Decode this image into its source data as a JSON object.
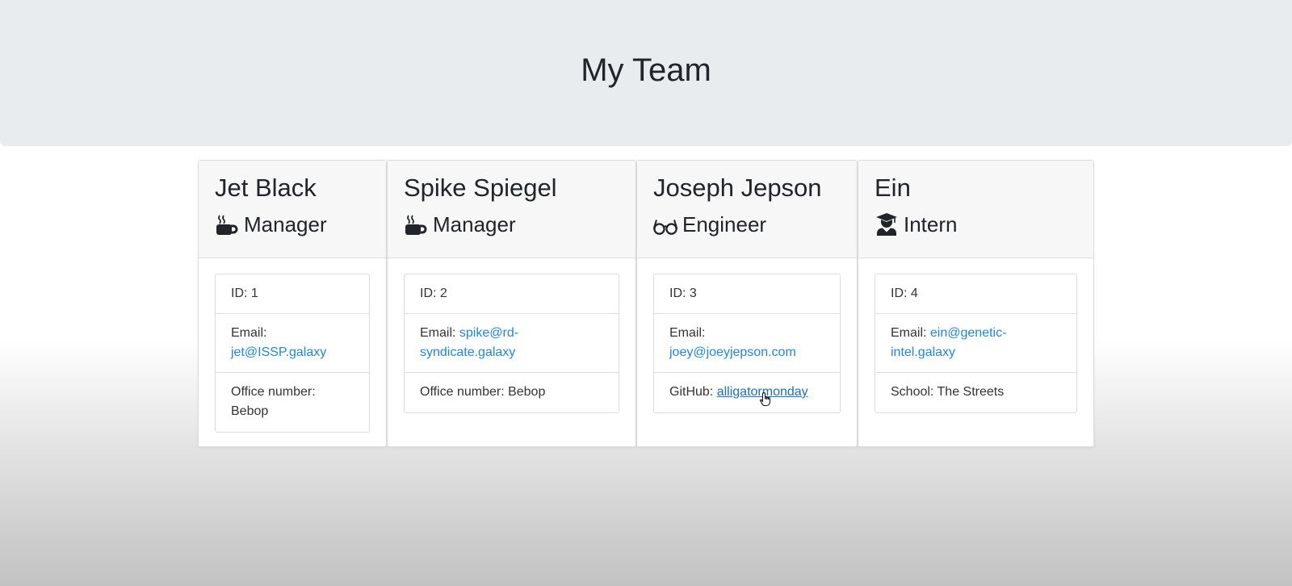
{
  "header": {
    "title": "My Team"
  },
  "colors": {
    "jumbotron": "#e9ecef",
    "card_header": "#f7f7f7",
    "link": "#1f86e0",
    "text": "#212529"
  },
  "team": [
    {
      "name": "Jet Black",
      "role": "Manager",
      "role_icon": "mug-hot-icon",
      "id_line": "ID: 1",
      "email_label": "Email:",
      "email": "jet@ISSP.galaxy",
      "extra_label": "Office number:",
      "extra_value": "Bebop"
    },
    {
      "name": "Spike Spiegel",
      "role": "Manager",
      "role_icon": "mug-hot-icon",
      "id_line": "ID: 2",
      "email_label": "Email:",
      "email_part1": "spike@rd-",
      "email_part2": "syndicate.galaxy",
      "extra_line": "Office number: Bebop"
    },
    {
      "name": "Joseph Jepson",
      "role": "Engineer",
      "role_icon": "glasses-icon",
      "id_line": "ID: 3",
      "email_label": "Email:",
      "email": "joey@joeyjepson.com",
      "extra_label": "GitHub:",
      "extra_value": "alligatormonday"
    },
    {
      "name": "Ein",
      "role": "Intern",
      "role_icon": "user-graduate-icon",
      "id_line": "ID: 4",
      "email_label": "Email:",
      "email_part1": "ein@genetic-",
      "email_part2": "intel.galaxy",
      "extra_line": "School: The Streets"
    }
  ]
}
